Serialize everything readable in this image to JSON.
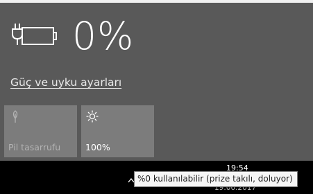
{
  "battery": {
    "percent_label": "0%",
    "icon": "battery-plugged-icon"
  },
  "power_settings_link": "Güç ve uyku ayarları",
  "quick_actions": [
    {
      "label": "Pil tasarrufu",
      "icon": "leaf-icon",
      "state": "disabled"
    },
    {
      "label": "100%",
      "icon": "brightness-icon",
      "state": "enabled"
    }
  ],
  "taskbar": {
    "time": "19:54",
    "date": "19.06.2017",
    "overflow_icon": "chevron-up-icon"
  },
  "tooltip": "%0 kullanılabilir (prize takılı, doluyor)",
  "colors": {
    "flyout_bg": "#595959",
    "tile_bg": "#7c7c7c",
    "taskbar_bg": "#000000",
    "tooltip_bg": "#f6f6f6"
  }
}
